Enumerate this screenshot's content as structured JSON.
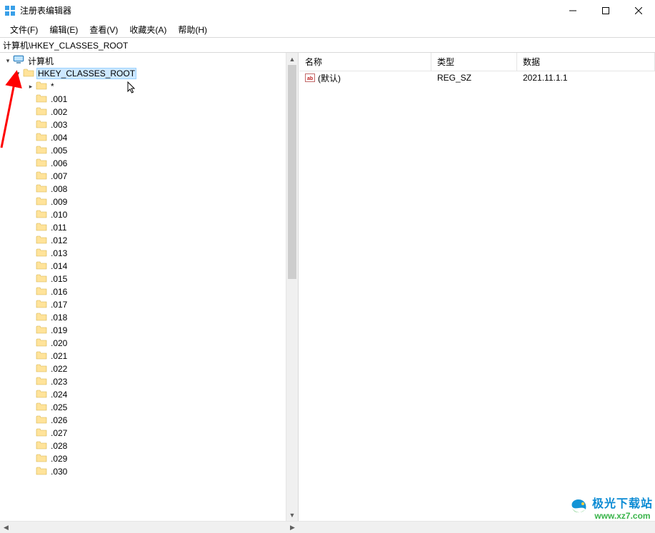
{
  "window": {
    "title": "注册表编辑器"
  },
  "menu": {
    "file": "文件(F)",
    "edit": "编辑(E)",
    "view": "查看(V)",
    "favorites": "收藏夹(A)",
    "help": "帮助(H)"
  },
  "address": {
    "path": "计算机\\HKEY_CLASSES_ROOT"
  },
  "tree": {
    "root": "计算机",
    "hkcr": "HKEY_CLASSES_ROOT",
    "star": "*",
    "children": [
      ".001",
      ".002",
      ".003",
      ".004",
      ".005",
      ".006",
      ".007",
      ".008",
      ".009",
      ".010",
      ".011",
      ".012",
      ".013",
      ".014",
      ".015",
      ".016",
      ".017",
      ".018",
      ".019",
      ".020",
      ".021",
      ".022",
      ".023",
      ".024",
      ".025",
      ".026",
      ".027",
      ".028",
      ".029",
      ".030"
    ]
  },
  "list": {
    "headers": {
      "name": "名称",
      "type": "类型",
      "data": "数据"
    },
    "rows": [
      {
        "name": "(默认)",
        "type": "REG_SZ",
        "data": "2021.11.1.1"
      }
    ]
  },
  "watermark": {
    "line1": "极光下载站",
    "line2": "www.xz7.com"
  }
}
